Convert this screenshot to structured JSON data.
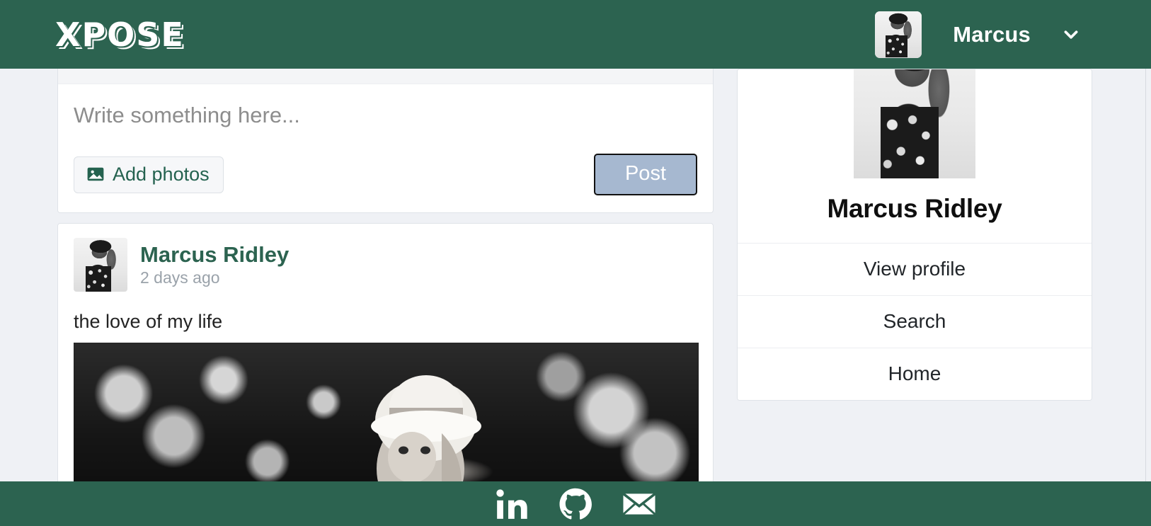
{
  "header": {
    "brand": "XPOSE",
    "user_name": "Marcus",
    "avatar_alt": "Marcus avatar",
    "chevron_icon": "chevron-down-icon"
  },
  "composer": {
    "placeholder": "Write something here...",
    "value": "",
    "add_photos_label": "Add photos",
    "add_photos_icon": "image-icon",
    "post_label": "Post"
  },
  "post": {
    "author": "Marcus Ridley",
    "time": "2 days ago",
    "text": "the love of my life",
    "avatar_alt": "Marcus Ridley avatar",
    "photo_alt": "Black and white photo of a woman wearing a wide-brimmed hat in a forest"
  },
  "sidebar": {
    "profile_name": "Marcus Ridley",
    "profile_photo_alt": "Marcus Ridley profile photo",
    "menu": [
      {
        "label": "View profile",
        "name": "view-profile"
      },
      {
        "label": "Search",
        "name": "search"
      },
      {
        "label": "Home",
        "name": "home"
      }
    ]
  },
  "footer": {
    "icons": [
      {
        "name": "linkedin-icon",
        "label": "LinkedIn"
      },
      {
        "name": "github-icon",
        "label": "GitHub"
      },
      {
        "name": "email-icon",
        "label": "Email"
      }
    ]
  },
  "colors": {
    "brand_green": "#2c6350",
    "page_background": "#eff1f5",
    "card_background": "#ffffff",
    "post_button": "#a6b8d0",
    "link_green": "#2c6350",
    "muted_text": "#9aa2aa"
  }
}
